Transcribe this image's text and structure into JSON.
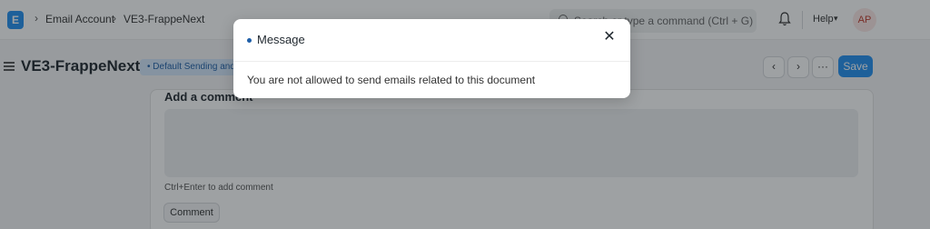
{
  "navbar": {
    "breadcrumbs": [
      "Email Account",
      "VE3-FrappeNext"
    ],
    "search_placeholder": "Search or type a command (Ctrl + G)",
    "help_label": "Help",
    "avatar_initials": "AP"
  },
  "page": {
    "title": "VE3-FrappeNext",
    "status_badge": "Default Sending and",
    "save_label": "Save",
    "more_label": "···"
  },
  "comment": {
    "heading": "Add a comment",
    "hint": "Ctrl+Enter to add comment",
    "button_label": "Comment"
  },
  "modal": {
    "title": "Message",
    "body": "You are not allowed to send emails related to this document"
  },
  "colors": {
    "primary": "#2490ef",
    "indicator": "#1f5fa8"
  }
}
